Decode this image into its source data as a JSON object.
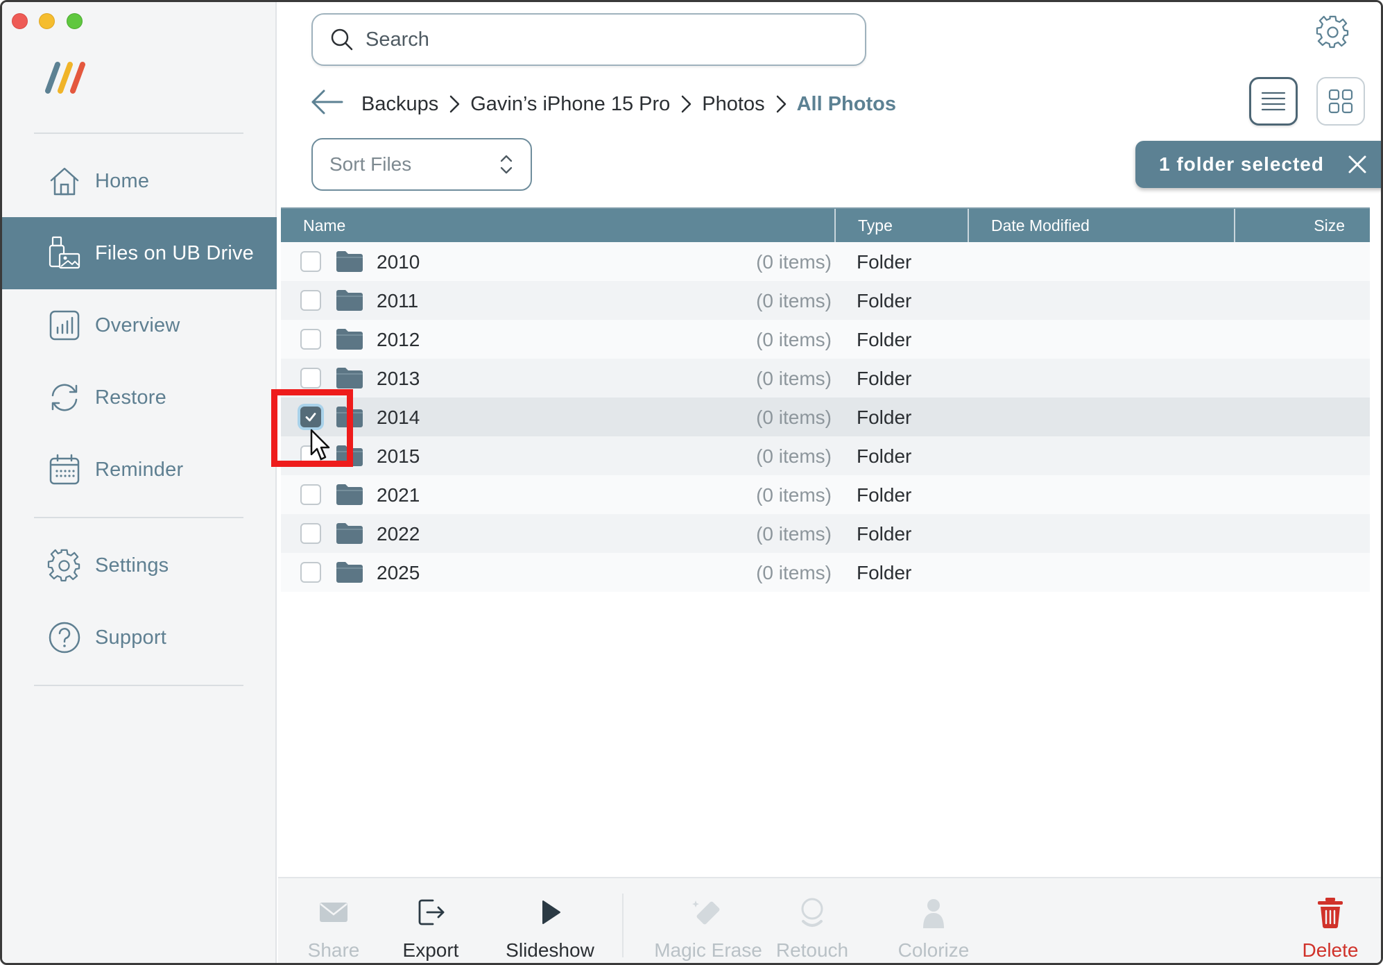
{
  "app": {
    "accent_color": "#5c8193",
    "danger_color": "#d0322a",
    "highlight_color": "#ee1c1c"
  },
  "sidebar": {
    "items": [
      {
        "label": "Home",
        "icon": "home-icon"
      },
      {
        "label": "Files on UB Drive",
        "icon": "usb-photos-icon",
        "active": true
      },
      {
        "label": "Overview",
        "icon": "bar-chart-icon"
      },
      {
        "label": "Restore",
        "icon": "restore-icon"
      },
      {
        "label": "Reminder",
        "icon": "calendar-icon"
      },
      {
        "label": "Settings",
        "icon": "gear-icon"
      },
      {
        "label": "Support",
        "icon": "help-icon"
      }
    ]
  },
  "search": {
    "placeholder": "Search",
    "value": ""
  },
  "breadcrumb": {
    "items": [
      "Backups",
      "Gavin’s iPhone 15 Pro",
      "Photos",
      "All Photos"
    ]
  },
  "sort": {
    "label": "Sort Files"
  },
  "selection": {
    "text": "1 folder selected"
  },
  "table": {
    "columns": [
      "Name",
      "Type",
      "Date Modified",
      "Size"
    ],
    "rows": [
      {
        "name": "2010",
        "count": "(0 items)",
        "type": "Folder",
        "checked": false
      },
      {
        "name": "2011",
        "count": "(0 items)",
        "type": "Folder",
        "checked": false
      },
      {
        "name": "2012",
        "count": "(0 items)",
        "type": "Folder",
        "checked": false
      },
      {
        "name": "2013",
        "count": "(0 items)",
        "type": "Folder",
        "checked": false
      },
      {
        "name": "2014",
        "count": "(0 items)",
        "type": "Folder",
        "checked": true
      },
      {
        "name": "2015",
        "count": "(0 items)",
        "type": "Folder",
        "checked": false
      },
      {
        "name": "2021",
        "count": "(0 items)",
        "type": "Folder",
        "checked": false
      },
      {
        "name": "2022",
        "count": "(0 items)",
        "type": "Folder",
        "checked": false
      },
      {
        "name": "2025",
        "count": "(0 items)",
        "type": "Folder",
        "checked": false
      }
    ]
  },
  "toolbar": {
    "share": "Share",
    "export": "Export",
    "slideshow": "Slideshow",
    "magic_erase": "Magic Erase",
    "retouch": "Retouch",
    "colorize": "Colorize",
    "delete": "Delete"
  }
}
